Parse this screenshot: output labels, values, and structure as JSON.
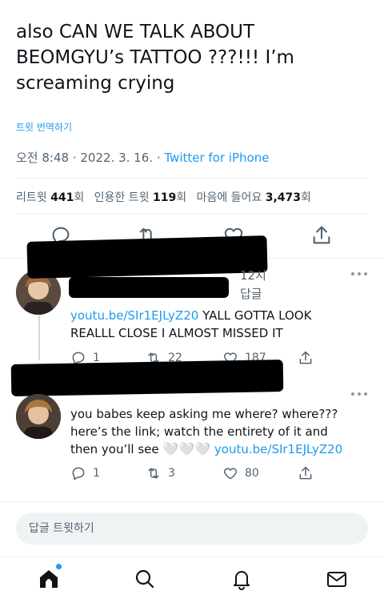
{
  "tweet": {
    "text": "also CAN WE TALK ABOUT BEOMGYU’s TATTOO ???!!! I’m screaming crying",
    "translate_label": "트윗 번역하기",
    "time": "오전 8:48",
    "date": "2022. 3. 16.",
    "source": "Twitter for iPhone"
  },
  "stats": {
    "retweets_label": "리트윗",
    "retweets_count": "441",
    "retweets_unit": "회",
    "quotes_label": "인용한 트윗",
    "quotes_count": "119",
    "quotes_unit": "회",
    "likes_label": "마음에 들어요",
    "likes_count": "3,473",
    "likes_unit": "회"
  },
  "replies": [
    {
      "time_partial": "12시",
      "reply_partial": "답글",
      "link": "youtu.be/SIr1EJLyZ20",
      "text": " YALL GOTTA LOOK REALLL CLOSE I ALMOST MISSED IT",
      "reply_count": "1",
      "retweet_count": "22",
      "like_count": "187"
    },
    {
      "text": "you babes keep asking me where? where??? here’s the link; watch the entirety of it and then you’ll see ",
      "hearts": "🤍🤍🤍",
      "link": "youtu.be/SIr1EJLyZ20",
      "reply_count": "1",
      "retweet_count": "3",
      "like_count": "80"
    }
  ],
  "compose": {
    "placeholder": "답글 트윗하기"
  },
  "nav": {
    "icons": [
      "home-icon",
      "search-icon",
      "notifications-icon",
      "messages-icon"
    ]
  },
  "colors": {
    "accent": "#1d9bf0",
    "text": "#0f1419",
    "muted": "#536471",
    "divider": "#eff3f4"
  }
}
